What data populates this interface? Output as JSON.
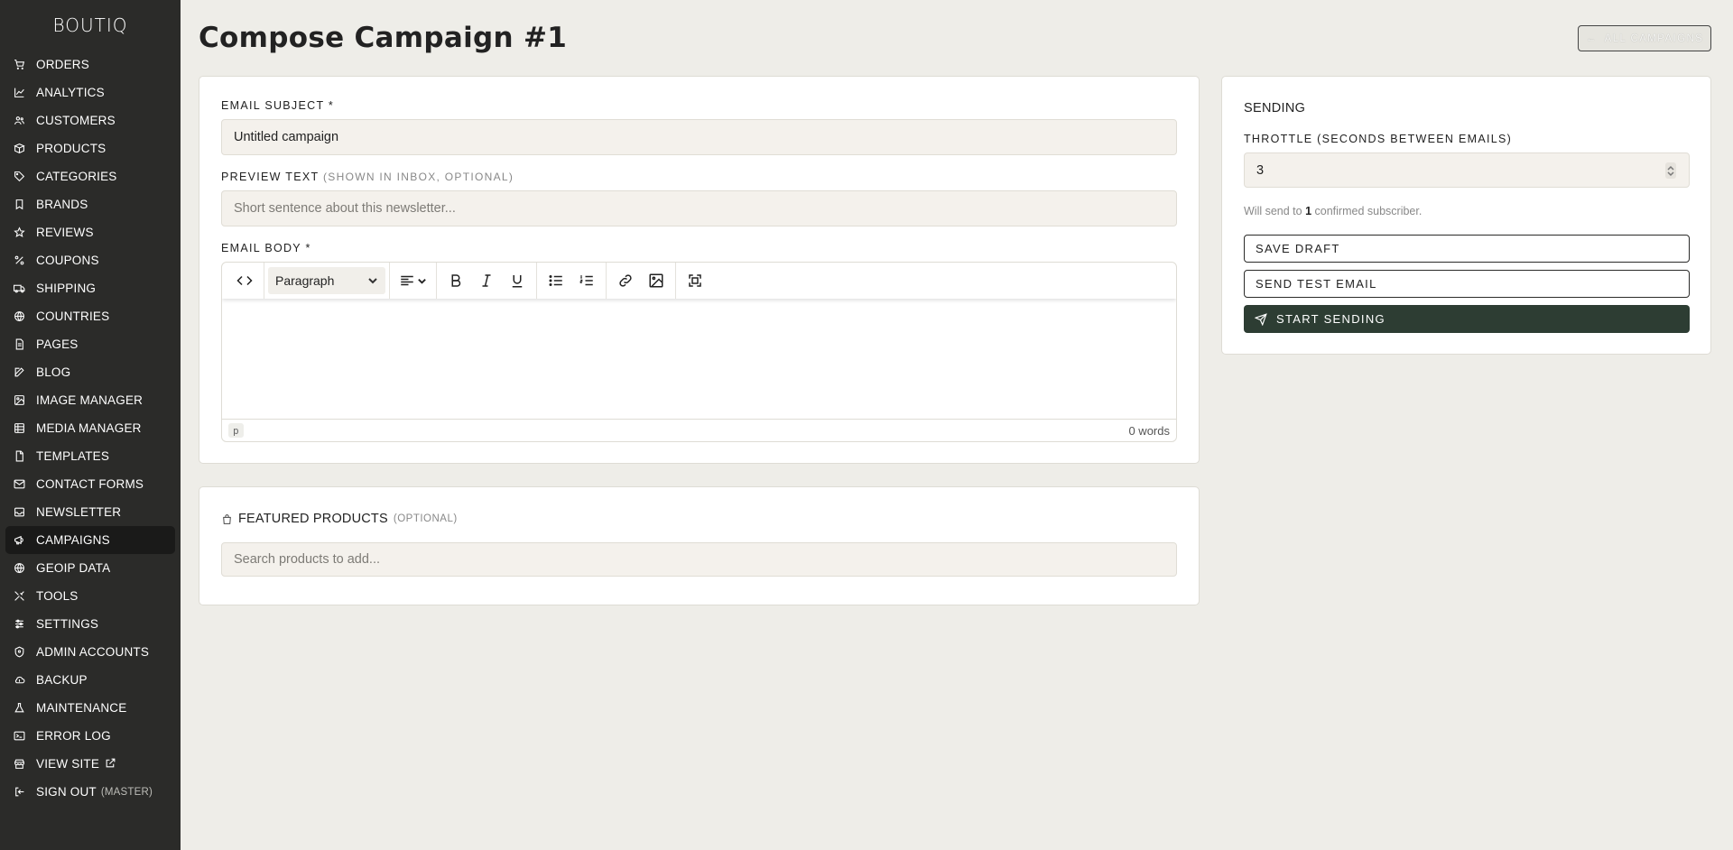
{
  "brand": "BOUTIQ",
  "nav": [
    {
      "label": "ORDERS",
      "icon": "cart-icon"
    },
    {
      "label": "ANALYTICS",
      "icon": "chart-line-icon"
    },
    {
      "label": "CUSTOMERS",
      "icon": "users-icon"
    },
    {
      "label": "PRODUCTS",
      "icon": "box-icon"
    },
    {
      "label": "CATEGORIES",
      "icon": "tag-icon"
    },
    {
      "label": "BRANDS",
      "icon": "bookmark-icon"
    },
    {
      "label": "REVIEWS",
      "icon": "star-icon"
    },
    {
      "label": "COUPONS",
      "icon": "percent-icon"
    },
    {
      "label": "SHIPPING",
      "icon": "truck-icon"
    },
    {
      "label": "COUNTRIES",
      "icon": "globe-icon"
    },
    {
      "label": "PAGES",
      "icon": "file-icon"
    },
    {
      "label": "BLOG",
      "icon": "edit-icon"
    },
    {
      "label": "IMAGE MANAGER",
      "icon": "image-icon"
    },
    {
      "label": "MEDIA MANAGER",
      "icon": "film-icon"
    },
    {
      "label": "TEMPLATES",
      "icon": "template-icon"
    },
    {
      "label": "CONTACT FORMS",
      "icon": "mail-icon"
    },
    {
      "label": "NEWSLETTER",
      "icon": "inbox-icon"
    },
    {
      "label": "CAMPAIGNS",
      "icon": "megaphone-icon",
      "active": true
    },
    {
      "label": "GEOIP DATA",
      "icon": "globe-icon"
    },
    {
      "label": "TOOLS",
      "icon": "tools-icon"
    },
    {
      "label": "SETTINGS",
      "icon": "sliders-icon"
    },
    {
      "label": "ADMIN ACCOUNTS",
      "icon": "shield-icon"
    },
    {
      "label": "BACKUP",
      "icon": "cloud-icon"
    },
    {
      "label": "MAINTENANCE",
      "icon": "flask-icon"
    },
    {
      "label": "ERROR LOG",
      "icon": "terminal-icon"
    },
    {
      "label": "VIEW SITE",
      "icon": "storefront-icon",
      "external": true
    },
    {
      "label": "SIGN OUT",
      "icon": "logout-icon",
      "suffix": "(MASTER)"
    }
  ],
  "header": {
    "title": "Compose Campaign #1",
    "back_button": "ALL CAMPAIGNS"
  },
  "form": {
    "subject_label": "EMAIL SUBJECT *",
    "subject_value": "Untitled campaign",
    "preview_label": "PREVIEW TEXT",
    "preview_hint": "(SHOWN IN INBOX, OPTIONAL)",
    "preview_placeholder": "Short sentence about this newsletter...",
    "body_label": "EMAIL BODY *"
  },
  "editor": {
    "block_format": "Paragraph",
    "path_tag": "p",
    "word_count": "0 words"
  },
  "sending": {
    "title": "SENDING",
    "throttle_label": "THROTTLE (SECONDS BETWEEN EMAILS)",
    "throttle_value": "3",
    "note_prefix": "Will send to ",
    "note_count": "1",
    "note_suffix": " confirmed subscriber.",
    "save_draft": "SAVE DRAFT",
    "send_test": "SEND TEST EMAIL",
    "start_sending": "START SENDING"
  },
  "featured": {
    "title": "FEATURED PRODUCTS",
    "hint": "(OPTIONAL)",
    "search_placeholder": "Search products to add..."
  },
  "colors": {
    "sidebar_bg": "#2b2b29",
    "page_bg": "#eeede8",
    "primary_button": "#2d3d33"
  }
}
